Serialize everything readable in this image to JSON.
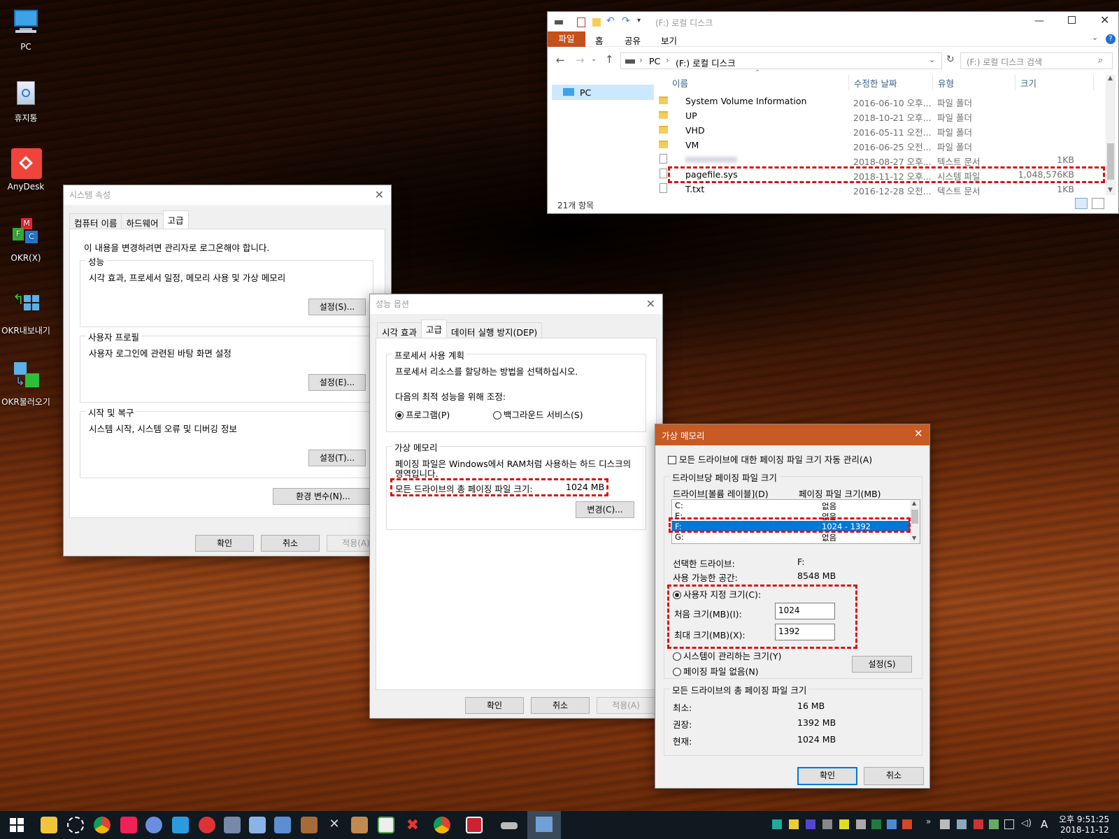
{
  "desktop": {
    "icons": [
      {
        "label": "PC",
        "icon": "pc-icon"
      },
      {
        "label": "휴지통",
        "icon": "recycle-bin-icon"
      },
      {
        "label": "AnyDesk",
        "icon": "anydesk-icon"
      },
      {
        "label": "OKR(X)",
        "icon": "okr-icon"
      },
      {
        "label": "OKR내보내기",
        "icon": "okr-export-icon"
      },
      {
        "label": "OKR불러오기",
        "icon": "okr-import-icon"
      }
    ]
  },
  "explorer": {
    "title": "(F:) 로컬 디스크",
    "ribbon_tabs": [
      "파일",
      "홈",
      "공유",
      "보기"
    ],
    "path": [
      "PC",
      "(F:) 로컬 디스크"
    ],
    "search_placeholder": "(F:) 로컬 디스크 검색",
    "nav_item": "PC",
    "columns": [
      "이름",
      "수정한 날짜",
      "유형",
      "크기"
    ],
    "rows": [
      {
        "name": "System Volume Information",
        "date": "2016-06-10 오후...",
        "type": "파일 폴더",
        "size": "",
        "kind": "folder"
      },
      {
        "name": "UP",
        "date": "2018-10-21 오후...",
        "type": "파일 폴더",
        "size": "",
        "kind": "folder"
      },
      {
        "name": "VHD",
        "date": "2016-05-11 오전...",
        "type": "파일 폴더",
        "size": "",
        "kind": "folder"
      },
      {
        "name": "VM",
        "date": "2016-06-25 오전...",
        "type": "파일 폴더",
        "size": "",
        "kind": "folder"
      },
      {
        "name": "",
        "date": "2018-08-27 오후...",
        "type": "텍스트 문서",
        "size": "1KB",
        "kind": "file"
      },
      {
        "name": "pagefile.sys",
        "date": "2018-11-12 오후...",
        "type": "시스템 파일",
        "size": "1,048,576KB",
        "kind": "file"
      },
      {
        "name": "T.txt",
        "date": "2016-12-28 오전...",
        "type": "텍스트 문서",
        "size": "1KB",
        "kind": "file"
      }
    ],
    "status": "21개 항목",
    "accent": "#c4501b"
  },
  "sysprops": {
    "title": "시스템 속성",
    "tabs": [
      "컴퓨터 이름",
      "하드웨어",
      "고급"
    ],
    "admin_note": "이 내용을 변경하려면 관리자로 로그온해야 합니다.",
    "perf_label": "성능",
    "perf_desc": "시각 효과, 프로세서 일정, 메모리 사용 및 가상 메모리",
    "perf_btn": "설정(S)...",
    "profile_label": "사용자 프로필",
    "profile_desc": "사용자 로그인에 관련된 바탕 화면 설정",
    "profile_btn": "설정(E)...",
    "startup_label": "시작 및 복구",
    "startup_desc": "시스템 시작, 시스템 오류 및 디버깅 정보",
    "startup_btn": "설정(T)...",
    "env_btn": "환경 변수(N)...",
    "ok": "확인",
    "cancel": "취소",
    "apply": "적용(A)"
  },
  "perfopts": {
    "title": "성능 옵션",
    "tabs": [
      "시각 효과",
      "고급",
      "데이터 실행 방지(DEP)"
    ],
    "sched_label": "프로세서 사용 계획",
    "sched_desc": "프로세서 리소스를 할당하는 방법을 선택하십시오.",
    "adjust_label": "다음의 최적 성능을 위해 조정:",
    "opt_programs": "프로그램(P)",
    "opt_background": "백그라운드 서비스(S)",
    "vm_label": "가상 메모리",
    "vm_desc1": "페이징 파일은 Windows에서 RAM처럼 사용하는 하드 디스크의",
    "vm_desc2": "영역입니다.",
    "total_label": "모든 드라이브의 총 페이징 파일 크기:",
    "total_value": "1024 MB",
    "change_btn": "변경(C)...",
    "ok": "확인",
    "cancel": "취소",
    "apply": "적용(A)"
  },
  "vmem": {
    "title": "가상 메모리",
    "auto_manage": "모든 드라이브에 대한 페이징 파일 크기 자동 관리(A)",
    "per_drive_label": "드라이브당 페이징 파일 크기",
    "col_drive": "드라이브[볼륨 레이블](D)",
    "col_size": "페이징 파일 크기(MB)",
    "drives": [
      {
        "drive": "C:",
        "size": "없음"
      },
      {
        "drive": "E:",
        "size": "없음"
      },
      {
        "drive": "F:",
        "size": "1024 - 1392"
      },
      {
        "drive": "G:",
        "size": "없음"
      }
    ],
    "selected_drive_label": "선택한 드라이브:",
    "selected_drive_value": "F:",
    "free_space_label": "사용 가능한 공간:",
    "free_space_value": "8548 MB",
    "custom_size": "사용자 지정 크기(C):",
    "initial_label": "처음 크기(MB)(I):",
    "initial_value": "1024",
    "max_label": "최대 크기(MB)(X):",
    "max_value": "1392",
    "system_managed": "시스템이 관리하는 크기(Y)",
    "no_paging": "페이징 파일 없음(N)",
    "set_btn": "설정(S)",
    "totals_label": "모든 드라이브의 총 페이징 파일 크기",
    "min_label": "최소:",
    "min_value": "16 MB",
    "rec_label": "권장:",
    "rec_value": "1392 MB",
    "cur_label": "현재:",
    "cur_value": "1024 MB",
    "ok": "확인",
    "cancel": "취소",
    "title_color": "#c85a24"
  },
  "taskbar": {
    "time": "오후 9:51:25",
    "date": "2018-11-12",
    "ime": "A"
  }
}
